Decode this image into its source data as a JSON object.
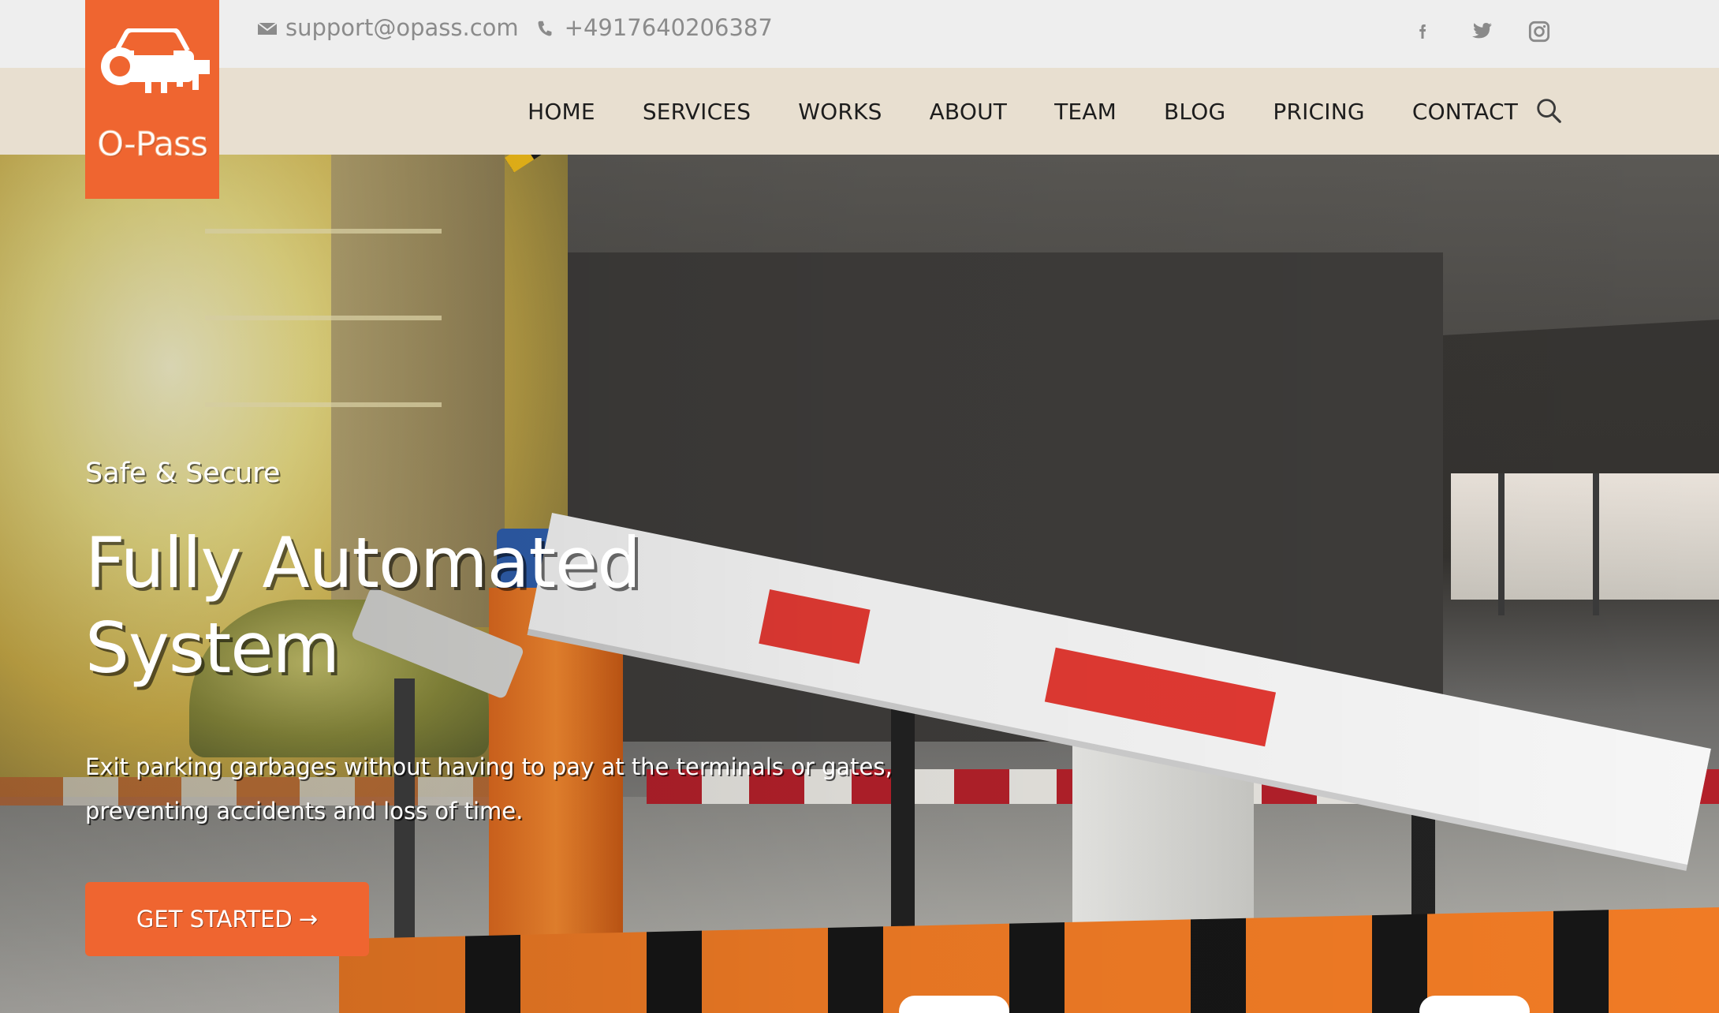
{
  "topbar": {
    "email": "support@opass.com",
    "phone": "+4917640206387",
    "social": [
      {
        "name": "facebook-icon"
      },
      {
        "name": "twitter-icon"
      },
      {
        "name": "instagram-icon"
      }
    ]
  },
  "logo": {
    "text": "O-Pass",
    "bg_color": "#ef6530"
  },
  "nav": {
    "items": [
      {
        "label": "HOME"
      },
      {
        "label": "SERVICES"
      },
      {
        "label": "WORKS"
      },
      {
        "label": "ABOUT"
      },
      {
        "label": "TEAM"
      },
      {
        "label": "BLOG"
      },
      {
        "label": "PRICING"
      },
      {
        "label": "CONTACT"
      }
    ],
    "search_icon": "search-icon"
  },
  "hero": {
    "eyebrow": "Safe & Secure",
    "headline_line1": "Fully Automated",
    "headline_line2": "System",
    "description_line1": "Exit parking garbages without having to pay at the terminals or gates,",
    "description_line2": "preventing accidents and loss of time.",
    "cta_label": "GET STARTED",
    "cta_arrow": "→"
  },
  "colors": {
    "accent": "#ef6530",
    "topbar_bg": "#eeeeee",
    "navbar_bg": "#e8dfd0"
  }
}
